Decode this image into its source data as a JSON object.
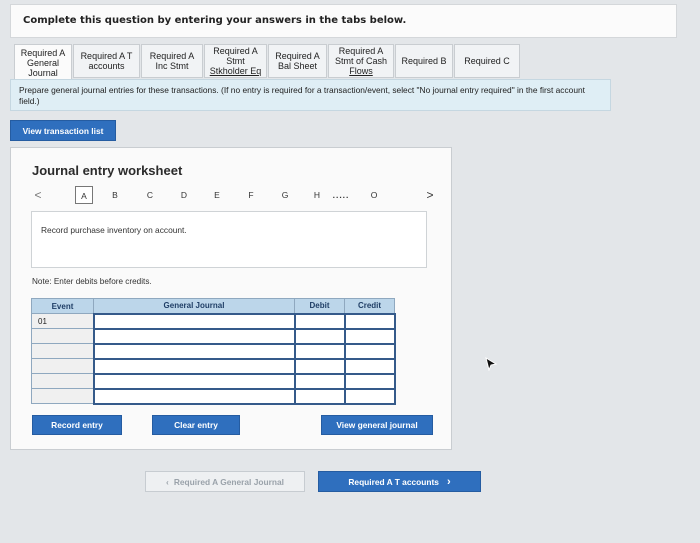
{
  "instruction": "Complete this question by entering your answers in the tabs below.",
  "tabs": [
    {
      "lines": [
        "Required A",
        "General",
        "Journal"
      ],
      "active": true
    },
    {
      "lines": [
        "Required A T",
        "accounts"
      ],
      "active": false
    },
    {
      "lines": [
        "Required A",
        "Inc Stmt"
      ],
      "active": false
    },
    {
      "lines": [
        "Required A",
        "Stmt",
        "Stkholder Eq"
      ],
      "active": false
    },
    {
      "lines": [
        "Required A",
        "Bal Sheet"
      ],
      "active": false
    },
    {
      "lines": [
        "Required A",
        "Stmt of Cash",
        "Flows"
      ],
      "active": false
    },
    {
      "lines": [
        "Required B"
      ],
      "active": false
    },
    {
      "lines": [
        "Required C"
      ],
      "active": false
    }
  ],
  "prepare_text": "Prepare general journal entries for these transactions. (If no entry is required for a transaction/event, select \"No journal entry required\" in the first account field.)",
  "view_transaction_label": "View transaction list",
  "worksheet": {
    "title": "Journal entry worksheet",
    "nav_items": [
      "A",
      "B",
      "C",
      "D",
      "E",
      "F",
      "G",
      "H",
      ".....",
      "O"
    ],
    "nav_prev": "<",
    "nav_next": ">",
    "description": "Record purchase inventory on account.",
    "note": "Note: Enter debits before credits.",
    "table_headers": {
      "event": "Event",
      "journal": "General Journal",
      "debit": "Debit",
      "credit": "Credit"
    },
    "event_value": "01",
    "record_label": "Record entry",
    "clear_label": "Clear entry",
    "view_journal_label": "View general journal"
  },
  "bottom_nav": {
    "prev_label": "Required A General Journal",
    "next_label": "Required A T accounts"
  },
  "colors": {
    "accent": "#2f6fbe",
    "table_header": "#bcd6ea",
    "prepare_bg": "#dfeef5"
  }
}
